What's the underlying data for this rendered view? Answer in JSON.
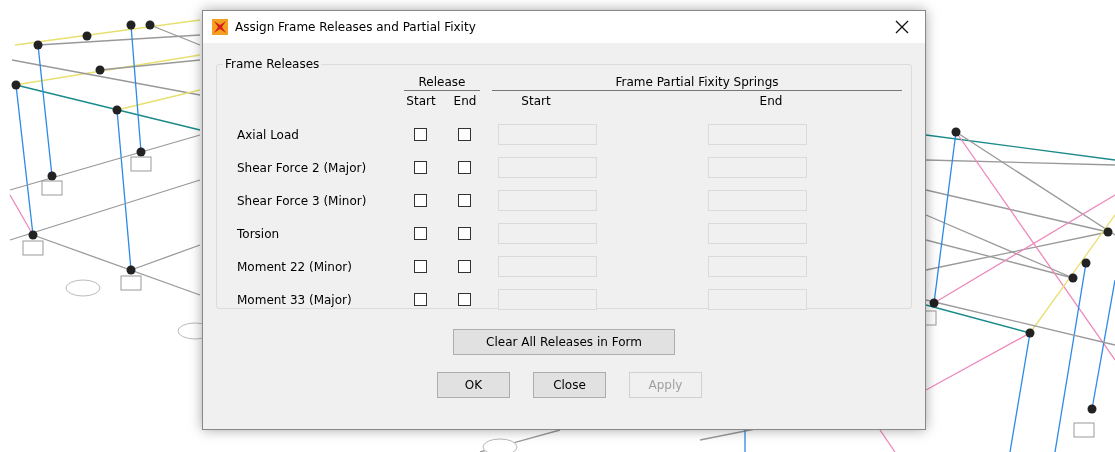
{
  "window": {
    "title": "Assign Frame Releases and Partial Fixity"
  },
  "group": {
    "title": "Frame Releases",
    "release_header": "Release",
    "release_columns": [
      "Start",
      "End"
    ],
    "springs_header": "Frame Partial Fixity Springs",
    "springs_columns": [
      "Start",
      "End"
    ],
    "rows": [
      {
        "label": "Axial Load",
        "start_checked": false,
        "end_checked": false,
        "springs_disabled": true
      },
      {
        "label": "Shear Force 2 (Major)",
        "start_checked": false,
        "end_checked": false,
        "springs_disabled": true
      },
      {
        "label": "Shear Force 3 (Minor)",
        "start_checked": false,
        "end_checked": false,
        "springs_disabled": true
      },
      {
        "label": "Torsion",
        "start_checked": false,
        "end_checked": false,
        "springs_disabled": true
      },
      {
        "label": "Moment 22 (Minor)",
        "start_checked": false,
        "end_checked": false,
        "springs_disabled": true
      },
      {
        "label": "Moment 33 (Major)",
        "start_checked": false,
        "end_checked": false,
        "springs_disabled": true
      }
    ]
  },
  "clear_button": {
    "label": "Clear All Releases in Form",
    "disabled": false
  },
  "buttons": [
    {
      "label": "OK",
      "disabled": false
    },
    {
      "label": "Close",
      "disabled": false
    },
    {
      "label": "Apply",
      "disabled": true
    }
  ]
}
